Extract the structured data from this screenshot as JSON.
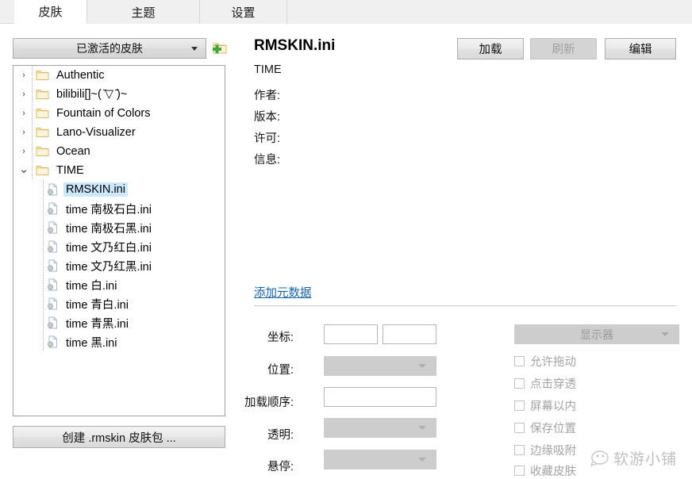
{
  "tabs": [
    {
      "label": "皮肤",
      "active": true
    },
    {
      "label": "主题",
      "active": false
    },
    {
      "label": "设置",
      "active": false
    }
  ],
  "sidebar": {
    "skin_filter": {
      "value": "已激活的皮肤",
      "icon": "chevron-down-icon"
    },
    "add_folder": {
      "icon": "folder-add-icon"
    },
    "tree": [
      {
        "label": "Authentic",
        "type": "folder",
        "expanded": false,
        "selected": false
      },
      {
        "label": "bilibili[]~( ̄▽ ̄)~",
        "type": "folder",
        "expanded": false,
        "selected": false
      },
      {
        "label": "Fountain of Colors",
        "type": "folder",
        "expanded": false,
        "selected": false
      },
      {
        "label": "Lano-Visualizer",
        "type": "folder",
        "expanded": false,
        "selected": false
      },
      {
        "label": "Ocean",
        "type": "folder",
        "expanded": false,
        "selected": false
      },
      {
        "label": "TIME",
        "type": "folder",
        "expanded": true,
        "selected": false
      },
      {
        "label": "RMSKIN.ini",
        "type": "file",
        "selected": true
      },
      {
        "label": "time 南极石白.ini",
        "type": "file",
        "selected": false
      },
      {
        "label": "time 南极石黑.ini",
        "type": "file",
        "selected": false
      },
      {
        "label": "time 文乃红白.ini",
        "type": "file",
        "selected": false
      },
      {
        "label": "time 文乃红黑.ini",
        "type": "file",
        "selected": false
      },
      {
        "label": "time 白.ini",
        "type": "file",
        "selected": false
      },
      {
        "label": "time 青白.ini",
        "type": "file",
        "selected": false
      },
      {
        "label": "time 青黑.ini",
        "type": "file",
        "selected": false
      },
      {
        "label": "time 黑.ini",
        "type": "file",
        "selected": false
      }
    ],
    "create_package_button": "创建 .rmskin 皮肤包 ..."
  },
  "details": {
    "skin_file": "RMSKIN.ini",
    "skin_config": "TIME",
    "meta_labels": [
      "作者:",
      "版本:",
      "许可:",
      "信息:"
    ],
    "meta_values": [
      "",
      "",
      "",
      ""
    ],
    "buttons": {
      "load": "加载",
      "refresh": "刷新",
      "edit": "编辑"
    },
    "add_metadata_link": "添加元数据"
  },
  "form": {
    "coordinates": {
      "label": "坐标:",
      "x": "",
      "y": ""
    },
    "position": {
      "label": "位置:",
      "value": ""
    },
    "load_order": {
      "label": "加载顺序:",
      "value": ""
    },
    "transparency": {
      "label": "透明:",
      "value": ""
    },
    "on_hover": {
      "label": "悬停:",
      "value": ""
    },
    "display": {
      "value": "显示器",
      "icon": "chevron-down-icon"
    },
    "checkboxes": [
      {
        "label": "允许拖动",
        "checked": false
      },
      {
        "label": "点击穿透",
        "checked": false
      },
      {
        "label": "屏幕以内",
        "checked": false
      },
      {
        "label": "保存位置",
        "checked": false
      },
      {
        "label": "边缘吸附",
        "checked": false
      },
      {
        "label": "收藏皮肤",
        "checked": false
      }
    ]
  },
  "watermark": {
    "text": "软游小铺",
    "icon": "smiley-face-icon"
  },
  "colors": {
    "tab_active_bg": "#ffffff",
    "tab_inactive_bg": "#f0f0f0",
    "selection_blue": "#cce8ff",
    "link_blue": "#1763ac",
    "disabled_gray": "#cdcdcd",
    "folder_yellow": "#fbe9b0"
  }
}
